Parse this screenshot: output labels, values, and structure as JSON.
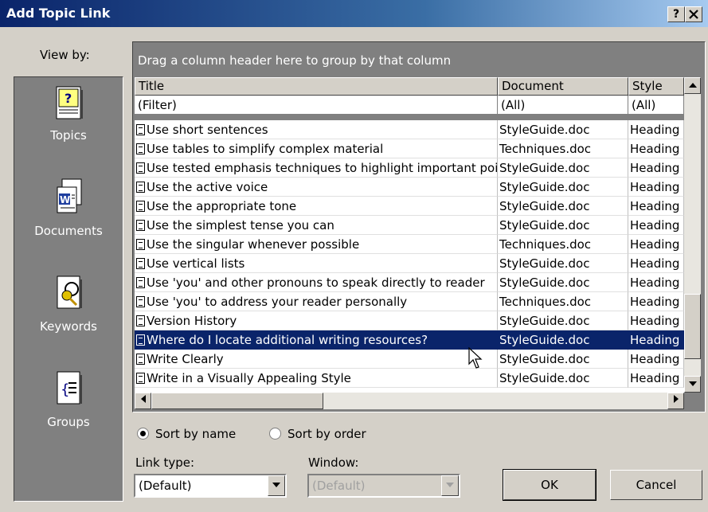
{
  "window": {
    "title": "Add Topic Link",
    "help_label": "?",
    "close_label": "X"
  },
  "view_by": {
    "label": "View by:",
    "items": [
      {
        "label": "Topics",
        "icon": "topics-icon"
      },
      {
        "label": "Documents",
        "icon": "documents-icon"
      },
      {
        "label": "Keywords",
        "icon": "keywords-icon"
      },
      {
        "label": "Groups",
        "icon": "groups-icon"
      }
    ]
  },
  "grid": {
    "group_hint": "Drag a column header here to group by that column",
    "columns": [
      "Title",
      "Document",
      "Style"
    ],
    "filters": [
      "(Filter)",
      "(All)",
      "(All)"
    ],
    "rows": [
      {
        "title": "Use short sentences",
        "document": "StyleGuide.doc",
        "style": "Heading"
      },
      {
        "title": "Use tables to simplify complex material",
        "document": "Techniques.doc",
        "style": "Heading"
      },
      {
        "title": "Use tested emphasis techniques to highlight important poi",
        "document": "StyleGuide.doc",
        "style": "Heading"
      },
      {
        "title": "Use the active voice",
        "document": "StyleGuide.doc",
        "style": "Heading"
      },
      {
        "title": "Use the appropriate tone",
        "document": "StyleGuide.doc",
        "style": "Heading"
      },
      {
        "title": "Use the simplest tense you can",
        "document": "StyleGuide.doc",
        "style": "Heading"
      },
      {
        "title": "Use the singular whenever possible",
        "document": "Techniques.doc",
        "style": "Heading"
      },
      {
        "title": "Use vertical lists",
        "document": "StyleGuide.doc",
        "style": "Heading"
      },
      {
        "title": "Use 'you' and other pronouns to speak directly to reader",
        "document": "StyleGuide.doc",
        "style": "Heading"
      },
      {
        "title": "Use 'you' to address your reader personally",
        "document": "Techniques.doc",
        "style": "Heading"
      },
      {
        "title": "Version History",
        "document": "StyleGuide.doc",
        "style": "Heading"
      },
      {
        "title": "Where do I locate additional writing resources?",
        "document": "StyleGuide.doc",
        "style": "Heading"
      },
      {
        "title": "Write Clearly",
        "document": "StyleGuide.doc",
        "style": "Heading"
      },
      {
        "title": "Write in a Visually Appealing Style",
        "document": "StyleGuide.doc",
        "style": "Heading"
      }
    ],
    "selected_row": 11
  },
  "sort": {
    "by_name": "Sort by name",
    "by_order": "Sort by order",
    "selected": "by_name"
  },
  "link_type": {
    "label": "Link type:",
    "value": "(Default)"
  },
  "window_field": {
    "label": "Window:",
    "value": "(Default)"
  },
  "buttons": {
    "ok": "OK",
    "cancel": "Cancel"
  },
  "colors": {
    "selection": "#0a246a",
    "face": "#d4d0c8",
    "panel": "#808080"
  }
}
